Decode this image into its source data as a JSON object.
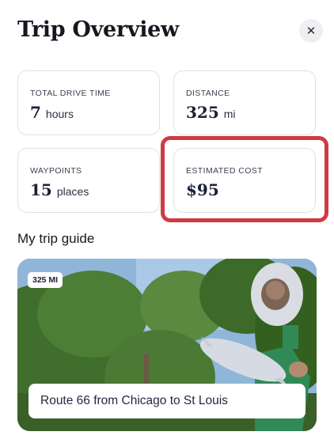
{
  "header": {
    "title": "Trip Overview",
    "close_icon": "close-icon"
  },
  "stats": {
    "drive_time": {
      "label": "TOTAL DRIVE TIME",
      "value": "7",
      "unit": "hours"
    },
    "distance": {
      "label": "DISTANCE",
      "value": "325",
      "unit": "mi"
    },
    "waypoints": {
      "label": "WAYPOINTS",
      "value": "15",
      "unit": "places"
    },
    "cost": {
      "label": "ESTIMATED COST",
      "value": "$95"
    }
  },
  "guide": {
    "heading": "My trip guide",
    "card": {
      "badge": "325 MI",
      "title": "Route 66 from Chicago to St Louis"
    }
  },
  "colors": {
    "highlight": "#cf3a45",
    "card_border": "#dfe2e8"
  }
}
